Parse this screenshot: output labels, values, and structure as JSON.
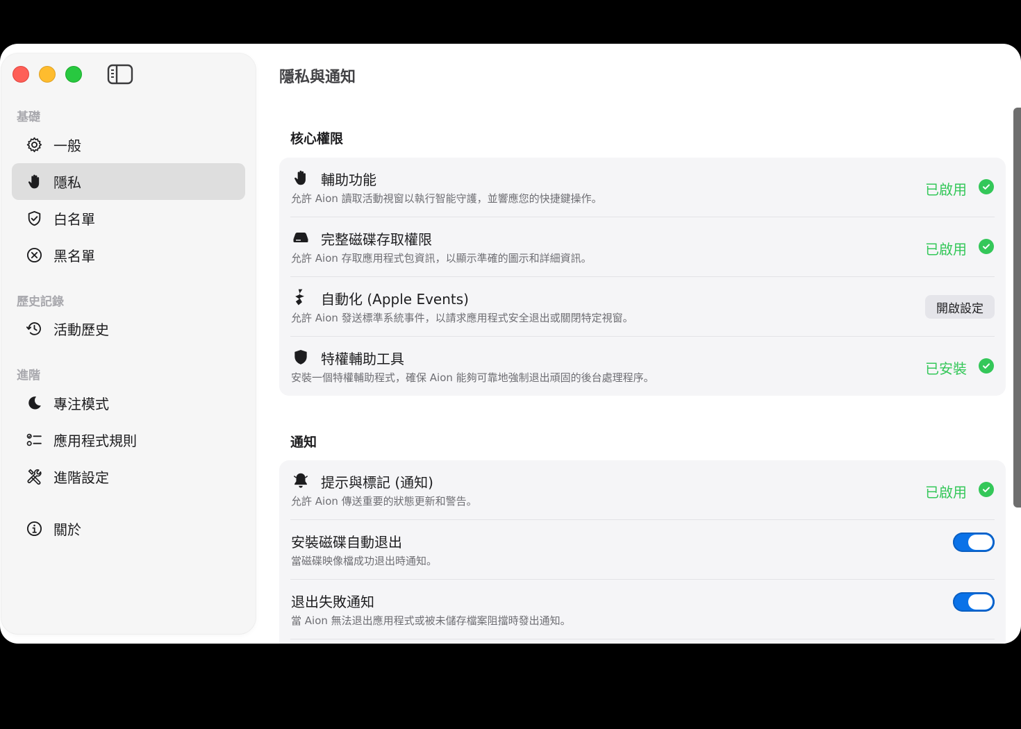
{
  "window": {
    "page_title": "隱私與通知"
  },
  "sidebar": {
    "sections": [
      {
        "title": "基礎"
      },
      {
        "title": "歷史記錄"
      },
      {
        "title": "進階"
      }
    ],
    "items": [
      {
        "label": "一般",
        "icon": "gear-icon"
      },
      {
        "label": "隱私",
        "icon": "hand-icon",
        "active": true
      },
      {
        "label": "白名單",
        "icon": "shield-check-icon"
      },
      {
        "label": "黑名單",
        "icon": "x-circle-icon"
      },
      {
        "label": "活動歷史",
        "icon": "history-icon"
      },
      {
        "label": "專注模式",
        "icon": "moon-icon"
      },
      {
        "label": "應用程式規則",
        "icon": "checklist-icon"
      },
      {
        "label": "進階設定",
        "icon": "tools-icon"
      },
      {
        "label": "關於",
        "icon": "info-icon"
      }
    ]
  },
  "core": {
    "title": "核心權限",
    "rows": [
      {
        "title": "輔助功能",
        "desc": "允許 Aion 讀取活動視窗以執行智能守護，並響應您的快捷鍵操作。",
        "status": "已啟用",
        "icon": "hand-icon"
      },
      {
        "title": "完整磁碟存取權限",
        "desc": "允許 Aion 存取應用程式包資訊，以顯示準確的圖示和詳細資訊。",
        "status": "已啟用",
        "icon": "disk-icon"
      },
      {
        "title": "自動化 (Apple Events)",
        "desc": "允許 Aion 發送標準系統事件，以請求應用程式安全退出或關閉特定視窗。",
        "button": "開啟設定",
        "icon": "automation-icon"
      },
      {
        "title": "特權輔助工具",
        "desc": "安裝一個特權輔助程式，確保 Aion 能夠可靠地強制退出頑固的後台處理程序。",
        "status": "已安裝",
        "icon": "shield-fill-icon"
      }
    ]
  },
  "notifications": {
    "title": "通知",
    "rows": [
      {
        "title": "提示與標記 (通知)",
        "desc": "允許 Aion 傳送重要的狀態更新和警告。",
        "status": "已啟用",
        "icon": "bell-icon"
      },
      {
        "title": "安裝磁碟自動退出",
        "desc": "當磁碟映像檔成功退出時通知。",
        "toggle": true
      },
      {
        "title": "退出失敗通知",
        "desc": "當 Aion 無法退出應用程式或被未儲存檔案阻擋時發出通知。",
        "toggle": true
      }
    ]
  },
  "colors": {
    "accent": "#0a72e8",
    "success": "#34c759",
    "close": "#fe5f57",
    "minimize": "#febc2e",
    "zoom": "#28c840"
  }
}
